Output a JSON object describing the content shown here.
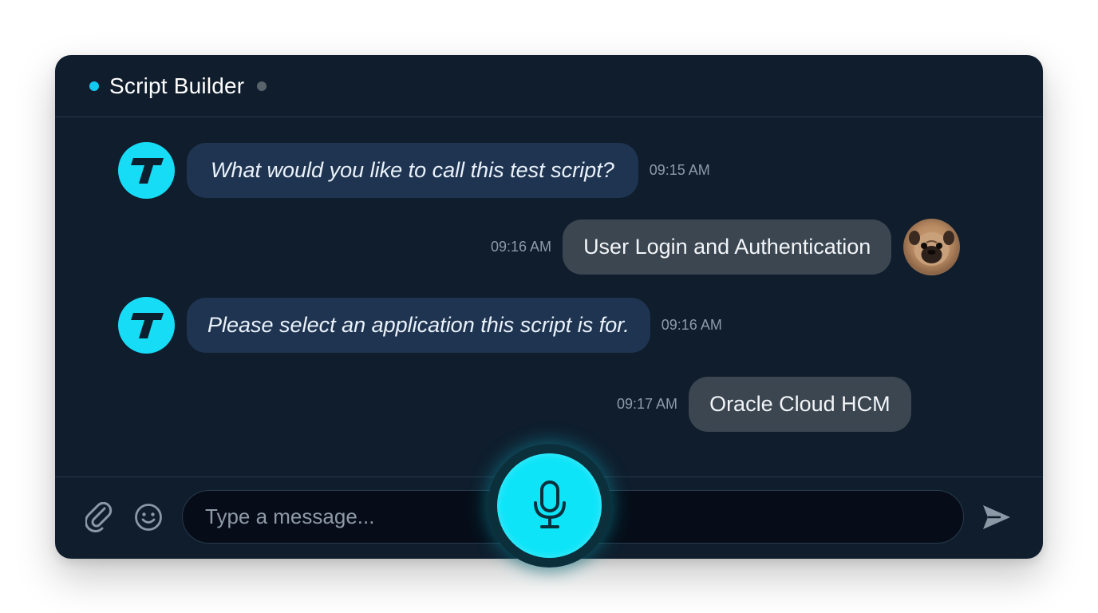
{
  "header": {
    "title": "Script Builder",
    "accent_color": "#14c8f0"
  },
  "messages": [
    {
      "sender": "bot",
      "text": "What would you like to call this test script?",
      "time": "09:15 AM"
    },
    {
      "sender": "user",
      "text": "User Login and Authentication",
      "time": "09:16 AM"
    },
    {
      "sender": "bot",
      "text": "Please select an application this script is for.",
      "time": "09:16 AM"
    },
    {
      "sender": "user",
      "text": "Oracle Cloud HCM",
      "time": "09:17 AM"
    }
  ],
  "composer": {
    "placeholder": "Type a message...",
    "icons": [
      "paperclip-icon",
      "smiley-icon",
      "microphone-icon",
      "send-icon"
    ]
  }
}
